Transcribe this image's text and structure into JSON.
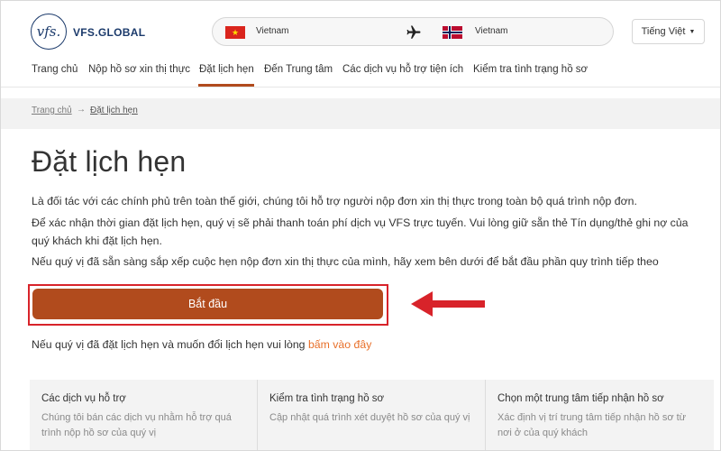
{
  "header": {
    "logo_mark": "vfs.",
    "logo_text": "VFS.GLOBAL",
    "route": {
      "from": "Vietnam",
      "to": "Vietnam"
    },
    "language": "Tiếng Việt"
  },
  "nav": {
    "items": [
      {
        "label": "Trang chủ"
      },
      {
        "label": "Nộp hồ sơ xin thị thực"
      },
      {
        "label": "Đặt lịch hẹn",
        "active": true
      },
      {
        "label": "Đến Trung tâm"
      },
      {
        "label": "Các dịch vụ hỗ trợ tiện ích"
      },
      {
        "label": "Kiểm tra tình trạng hồ sơ"
      }
    ]
  },
  "breadcrumb": {
    "home": "Trang chủ",
    "separator": "→",
    "current": "Đặt lịch hẹn"
  },
  "main": {
    "title": "Đặt lịch hẹn",
    "paragraphs": [
      "Là đối tác với các chính phủ trên toàn thế giới, chúng tôi hỗ trợ người nộp đơn xin thị thực trong toàn bộ quá trình nộp đơn.",
      "Để xác nhận thời gian đặt lịch hẹn, quý vị sẽ phải thanh toán phí dịch vụ VFS trực tuyến. Vui lòng giữ sẵn thẻ Tín dụng/thẻ ghi nợ của",
      "quý khách khi đặt lịch hẹn.",
      "Nếu quý vị đã sẵn sàng sắp xếp cuộc hẹn nộp đơn xin thị thực của mình, hãy xem bên dưới để bắt đầu phần quy trình tiếp theo"
    ],
    "start_button": "Bắt đầu",
    "reschedule_text": "Nếu quý vị đã đặt lịch hẹn và muốn đổi lịch hẹn vui lòng ",
    "reschedule_link": "bấm vào đây"
  },
  "cards": [
    {
      "title": "Các dịch vụ hỗ trợ",
      "desc": "Chúng tôi bán các dịch vụ nhằm hỗ trợ quá trình nộp hồ sơ của quý vị"
    },
    {
      "title": "Kiểm tra tình trạng hồ sơ",
      "desc": "Cập nhật quá trình xét duyệt hồ sơ của quý vị"
    },
    {
      "title": "Chọn một trung tâm tiếp nhận hồ sơ",
      "desc": "Xác định vị trí trung tâm tiếp nhận hồ sơ từ nơi ở của quý khách"
    }
  ],
  "colors": {
    "brand_navy": "#1b3a6b",
    "primary_button": "#b14b1d",
    "link_orange": "#e8702a",
    "annotation_red": "#d8232a"
  },
  "icons": {
    "plane": "airplane-icon",
    "caret": "caret-down-icon",
    "arrow": "annotation-arrow-icon"
  }
}
